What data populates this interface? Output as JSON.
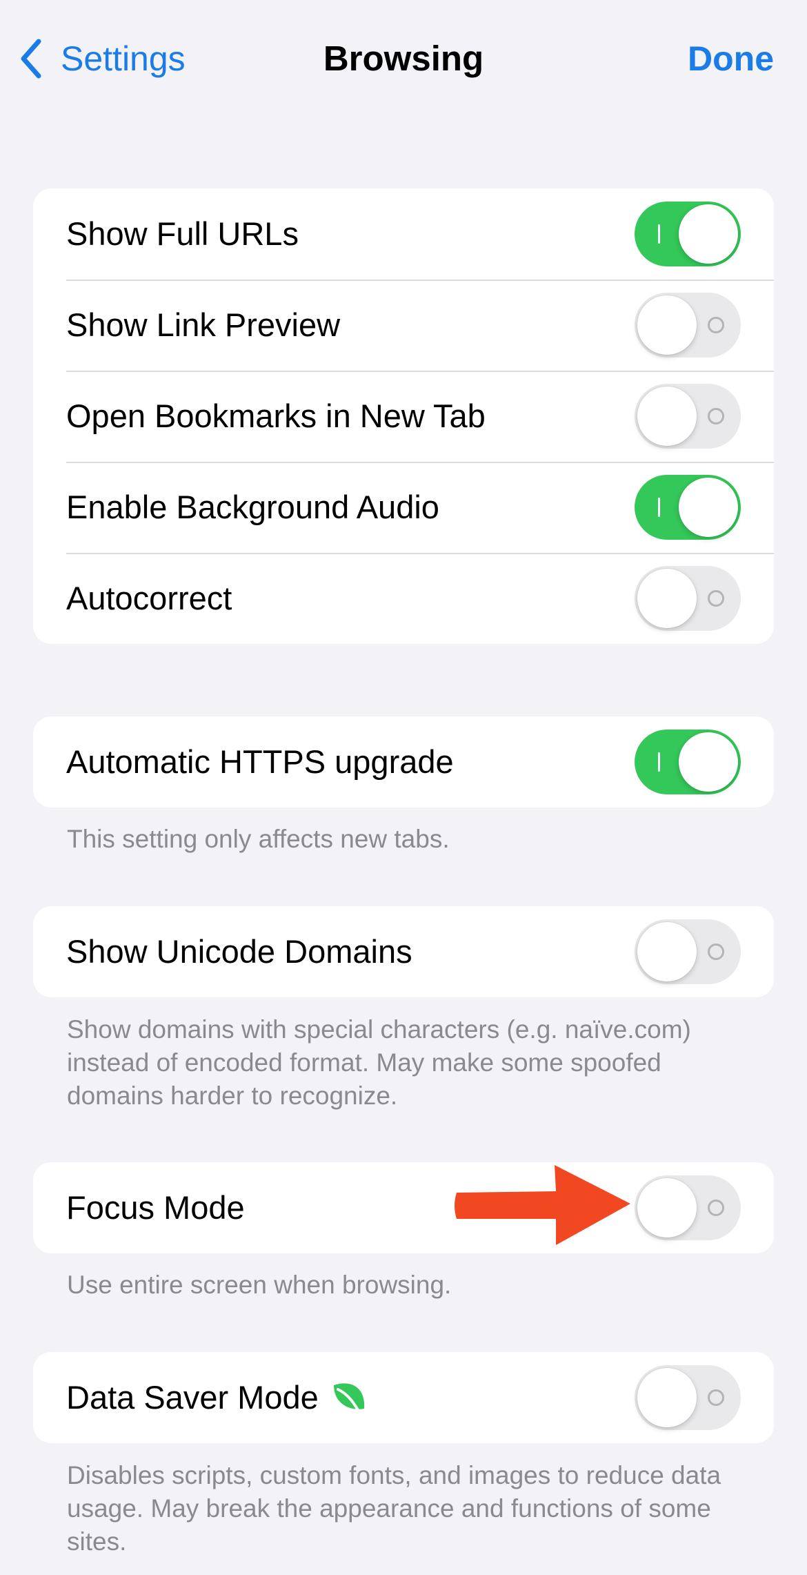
{
  "nav": {
    "back_label": "Settings",
    "title": "Browsing",
    "done_label": "Done"
  },
  "group1": {
    "rows": [
      {
        "label": "Show Full URLs",
        "on": true
      },
      {
        "label": "Show Link Preview",
        "on": false
      },
      {
        "label": "Open Bookmarks in New Tab",
        "on": false
      },
      {
        "label": "Enable Background Audio",
        "on": true
      },
      {
        "label": "Autocorrect",
        "on": false
      }
    ]
  },
  "https": {
    "label": "Automatic HTTPS upgrade",
    "on": true,
    "footer": "This setting only affects new tabs."
  },
  "unicode": {
    "label": "Show Unicode Domains",
    "on": false,
    "footer": "Show domains with special characters (e.g. naïve.com) instead of encoded format. May make some spoofed domains harder to recognize."
  },
  "focus": {
    "label": "Focus Mode",
    "on": false,
    "footer": "Use entire screen when browsing."
  },
  "datasaver": {
    "label": "Data Saver Mode",
    "icon": "leaf-icon",
    "on": false,
    "footer": "Disables scripts, custom fonts, and images to reduce data usage. May break the appearance and functions of some sites."
  },
  "colors": {
    "accent": "#1A7CE6",
    "toggle_on": "#34C759",
    "toggle_off": "#E9E9EB",
    "arrow": "#F24822",
    "leaf": "#34C759",
    "background": "#F2F2F7"
  }
}
